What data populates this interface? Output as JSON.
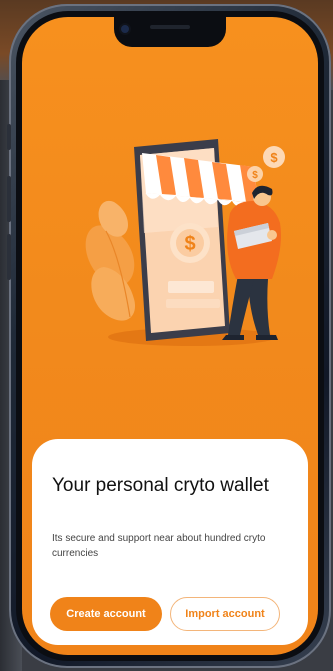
{
  "onboarding": {
    "title": "Your personal cryto wallet",
    "description": "Its secure and support near about hundred cryto currencies",
    "create_account_label": "Create account",
    "import_account_label": "Import account"
  },
  "illustration": {
    "currency_symbol": "$"
  },
  "colors": {
    "accent": "#f08319",
    "screen_background": "#f7901e",
    "card_background": "#ffffff",
    "secondary_button_border": "#f3b57a"
  }
}
